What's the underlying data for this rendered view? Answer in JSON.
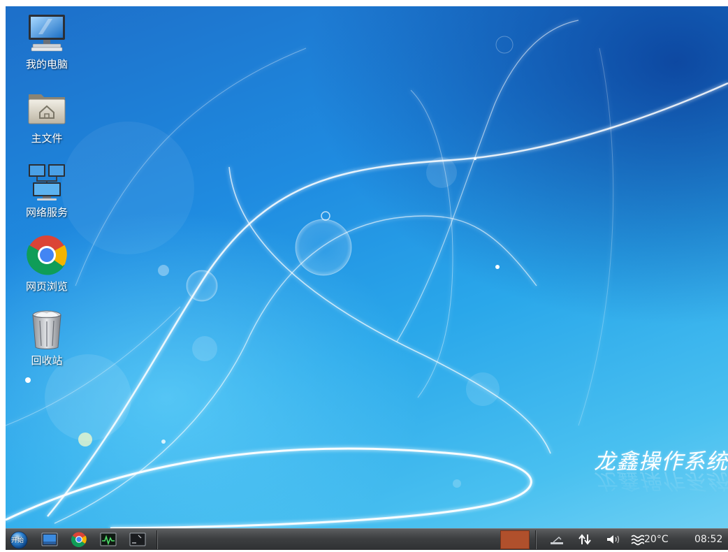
{
  "desktop": {
    "brand_text": "龙鑫操作系统",
    "icons": [
      {
        "label": "我的电脑",
        "icon": "computer-icon"
      },
      {
        "label": "主文件",
        "icon": "home-folder-icon"
      },
      {
        "label": "网络服务",
        "icon": "network-icon"
      },
      {
        "label": "网页浏览",
        "icon": "chrome-icon"
      },
      {
        "label": "回收站",
        "icon": "trash-icon"
      }
    ]
  },
  "taskbar": {
    "start_label": "开始",
    "launchers": [
      "show-desktop-icon",
      "chrome-icon",
      "system-monitor-icon",
      "terminal-icon"
    ],
    "tray": {
      "temperature": "20°C",
      "clock": "08:52"
    }
  },
  "colors": {
    "taskbar_active": "#b0502c",
    "desktop_blue": "#1f8be0"
  }
}
